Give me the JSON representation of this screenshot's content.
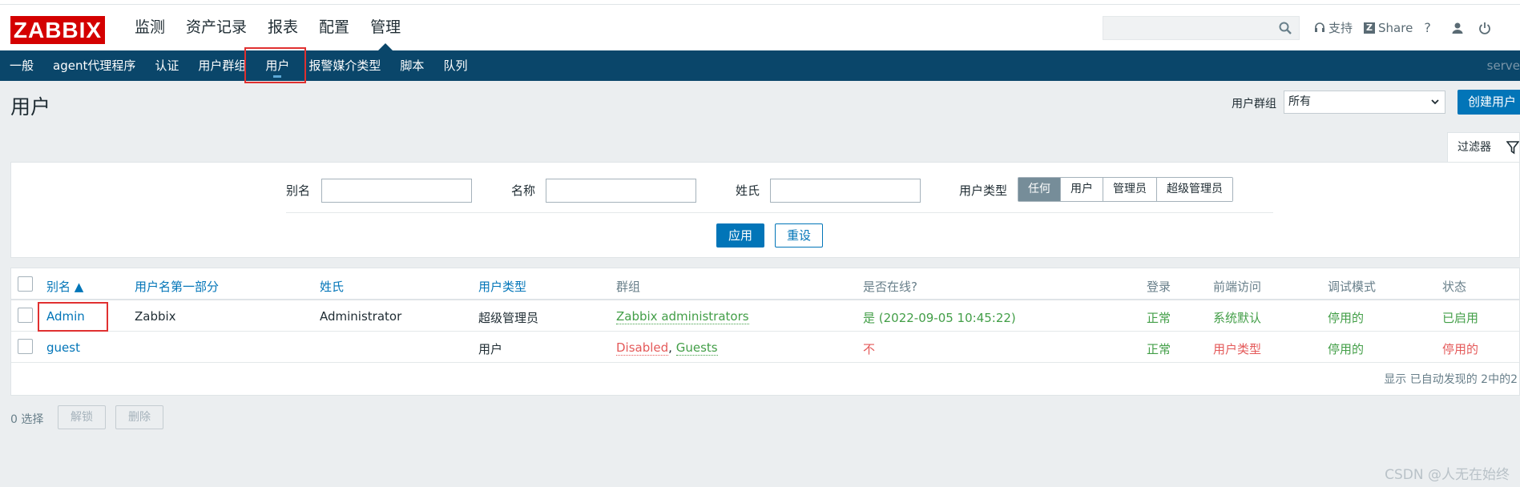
{
  "header": {
    "logo": "ZABBIX",
    "menu": [
      "监测",
      "资产记录",
      "报表",
      "配置",
      "管理"
    ],
    "search_placeholder": "",
    "support": "支持",
    "share": "Share",
    "help": "?"
  },
  "subnav": {
    "items": [
      "一般",
      "agent代理程序",
      "认证",
      "用户群组",
      "用户",
      "报警媒介类型",
      "脚本",
      "队列"
    ],
    "right_text": "serve"
  },
  "page": {
    "title": "用户",
    "usergroup_label": "用户群组",
    "usergroup_value": "所有",
    "create_button": "创建用户"
  },
  "filter": {
    "tab_label": "过滤器",
    "alias_label": "别名",
    "name_label": "名称",
    "surname_label": "姓氏",
    "usertype_label": "用户类型",
    "usertype_options": [
      "任何",
      "用户",
      "管理员",
      "超级管理员"
    ],
    "usertype_selected": "任何",
    "apply": "应用",
    "reset": "重设"
  },
  "table": {
    "headers": [
      "别名 ▲",
      "用户名第一部分",
      "姓氏",
      "用户类型",
      "群组",
      "是否在线?",
      "登录",
      "前端访问",
      "调试模式",
      "状态"
    ],
    "rows": [
      {
        "alias": "Admin",
        "name": "Zabbix",
        "surname": "Administrator",
        "type": "超级管理员",
        "group_a": "Zabbix administrators",
        "group_sep": "",
        "group_b": "",
        "online": "是 (2022-09-05 10:45:22)",
        "login": "正常",
        "frontend": "系统默认",
        "debug": "停用的",
        "status": "已启用"
      },
      {
        "alias": "guest",
        "name": "",
        "surname": "",
        "type": "用户",
        "group_a": "Disabled",
        "group_sep": ", ",
        "group_b": "Guests",
        "online": "不",
        "login": "正常",
        "frontend": "用户类型",
        "debug": "停用的",
        "status": "停用的"
      }
    ],
    "footer": "显示 已自动发现的 2中的2"
  },
  "bottom": {
    "selected": "0 选择",
    "unlock": "解锁",
    "delete": "删除"
  },
  "watermark": "CSDN @人无在始终"
}
